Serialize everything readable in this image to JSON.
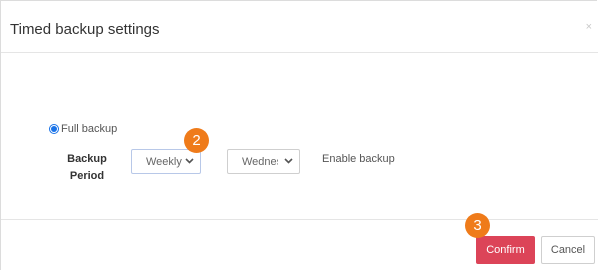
{
  "dialog": {
    "title": "Timed backup settings",
    "close_glyph": "×"
  },
  "backup_type": {
    "option_label": "Full backup",
    "selected": true
  },
  "backup_period": {
    "label_line1": "Backup",
    "label_line2": "Period",
    "frequency_value": "Weekly",
    "day_value": "Wednesday",
    "dropdown_icon": "chevron-down-icon"
  },
  "enable": {
    "label": "Enable backup"
  },
  "markers": {
    "step2": "2",
    "step3": "3",
    "color": "#ef7b1a"
  },
  "footer": {
    "confirm_label": "Confirm",
    "cancel_label": "Cancel",
    "confirm_color": "#dc4458"
  }
}
